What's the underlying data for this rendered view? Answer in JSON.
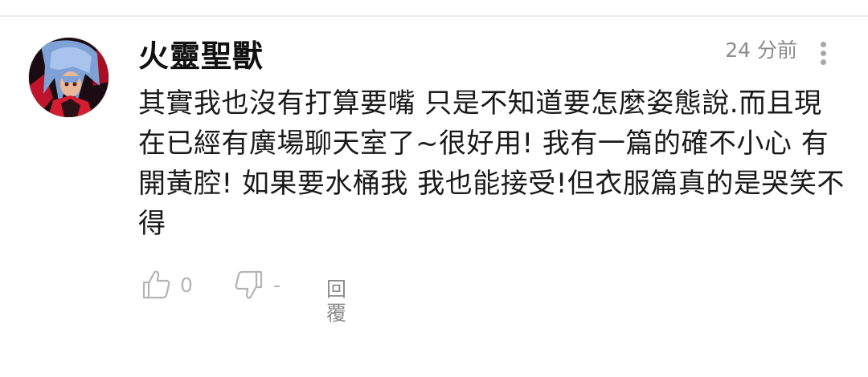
{
  "comment": {
    "author": "火靈聖獸",
    "timestamp": "24 分前",
    "body": "其實我也沒有打算要嘴 只是不知道要怎麼姿態說.而且現在已經有廣場聊天室了~很好用! 我有一篇的確不小心 有開黃腔! 如果要水桶我 我也能接受!但衣服篇真的是哭笑不得",
    "likes": "0",
    "dislikes": "-",
    "reply_label": "回覆"
  },
  "icons": {
    "like": "thumbs-up-icon",
    "dislike": "thumbs-down-icon",
    "menu": "more-vertical-icon"
  },
  "colors": {
    "text": "#1a1a1a",
    "muted": "#8c8c8c",
    "icon": "#b4b4b4"
  }
}
